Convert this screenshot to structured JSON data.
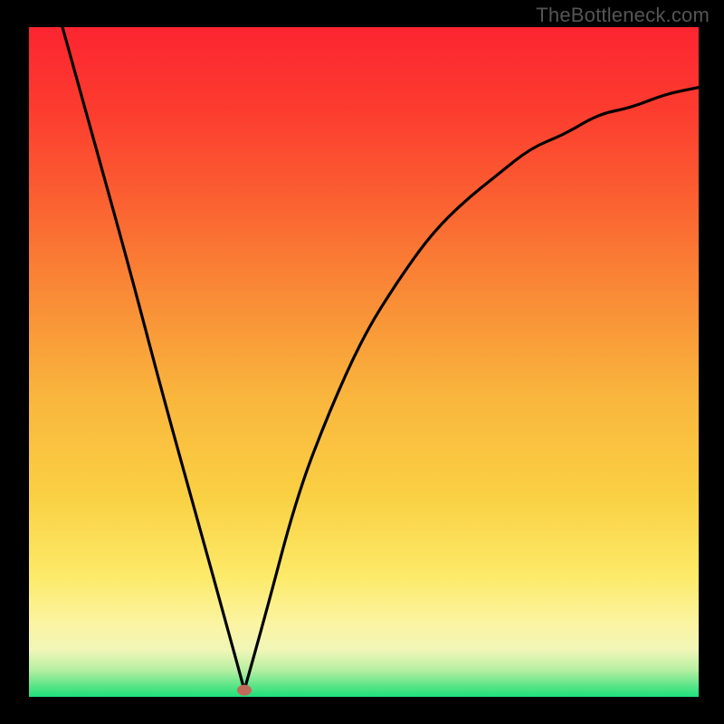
{
  "watermark": "TheBottleneck.com",
  "chart_data": {
    "type": "line",
    "title": "",
    "xlabel": "",
    "ylabel": "",
    "xlim": [
      0,
      1
    ],
    "ylim": [
      0,
      1
    ],
    "x": [
      0.05,
      0.1,
      0.15,
      0.2,
      0.25,
      0.3,
      0.3216,
      0.35,
      0.4,
      0.45,
      0.5,
      0.55,
      0.6,
      0.65,
      0.7,
      0.75,
      0.8,
      0.85,
      0.9,
      0.95,
      1.0
    ],
    "y": [
      1.0,
      0.82,
      0.64,
      0.45,
      0.27,
      0.09,
      0.01,
      0.11,
      0.3,
      0.43,
      0.54,
      0.62,
      0.69,
      0.74,
      0.78,
      0.82,
      0.84,
      0.87,
      0.88,
      0.9,
      0.91
    ],
    "marker_x": 0.3216,
    "marker_y": 0.01,
    "gradient_top_color": "#fc2530",
    "gradient_mid_color": "#fad043",
    "gradient_band_color": "#fbf4a2",
    "gradient_bottom_color": "#1ee07b"
  }
}
